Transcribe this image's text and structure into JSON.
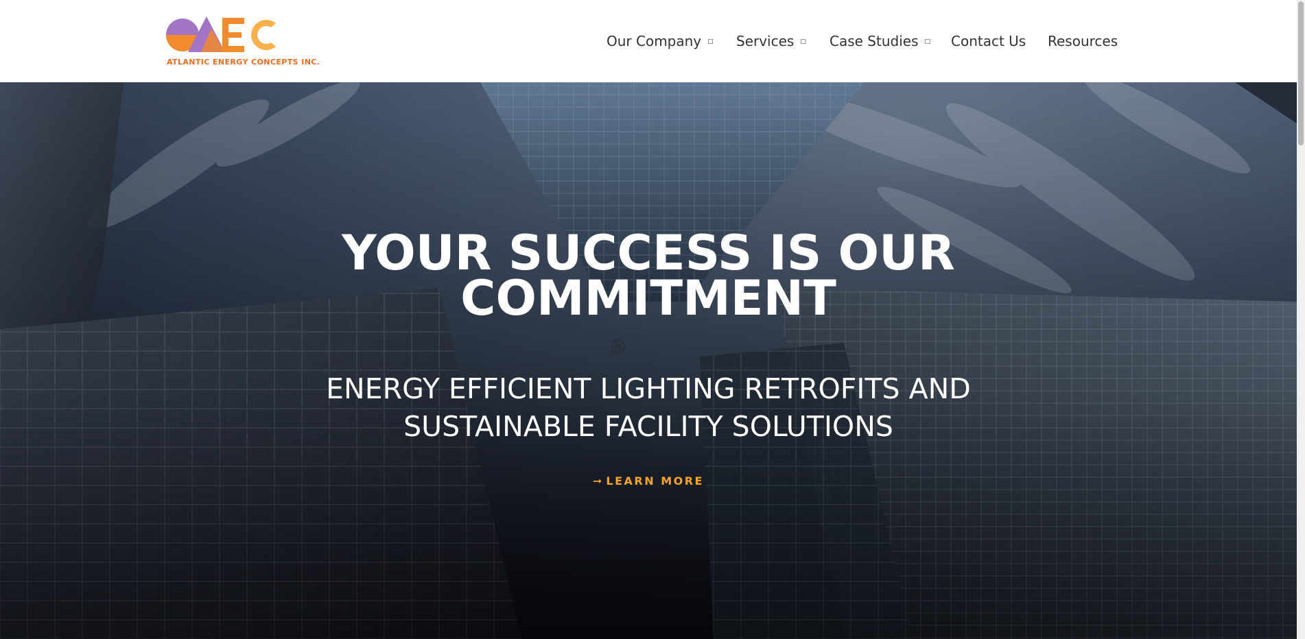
{
  "header": {
    "logo": {
      "mark": "AEC",
      "tagline": "ATLANTIC ENERGY CONCEPTS INC.",
      "colors": {
        "purple": "#a276c4",
        "orange": "#f28a2e",
        "light_orange": "#f7b04a"
      }
    },
    "nav": {
      "items": [
        {
          "label": "Our Company",
          "has_dropdown": true
        },
        {
          "label": "Services",
          "has_dropdown": true
        },
        {
          "label": "Case Studies",
          "has_dropdown": true
        },
        {
          "label": "Contact Us",
          "has_dropdown": false
        },
        {
          "label": "Resources",
          "has_dropdown": false
        }
      ],
      "dropdown_icon": "dropdown-caret-icon"
    }
  },
  "hero": {
    "title_line1": "YOUR SUCCESS IS OUR",
    "title_line2": "COMMITMENT",
    "subtitle_line1": "ENERGY EFFICIENT LIGHTING RETROFITS AND",
    "subtitle_line2": "SUSTAINABLE FACILITY SOLUTIONS",
    "cta": {
      "icon": "arrow-right-icon",
      "label": "LEARN MORE",
      "color": "#f7a42a"
    },
    "background": "skyscrapers-looking-up-photo"
  }
}
